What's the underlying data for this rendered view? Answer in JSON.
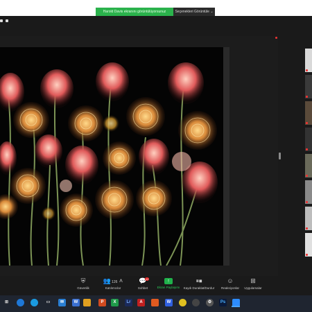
{
  "share_banner": {
    "message": "Harold Davis ekranını görüntülüyorsunuz",
    "view_options": "Seçenekleri Görüntüle ⌄"
  },
  "toolbar": {
    "security": "Güvenlik",
    "participants": "Katılımcılar",
    "participant_count": "126",
    "chat": "Sohbet",
    "chat_badge": "12",
    "share_screen": "Ekran Paylaşımı",
    "record": "Kaydı Duraklat/Durdur",
    "reactions": "Reaksiyonlar",
    "apps": "Uygulamalar"
  },
  "colors": {
    "share_green": "#2bb24c",
    "background_dark": "#1a1a1a",
    "taskbar": "#1f2530",
    "recording_red": "#e33333"
  },
  "taskbar_icons": [
    "windows-start",
    "search",
    "chrome",
    "edge",
    "file-explorer",
    "mail",
    "word",
    "excel",
    "powerpoint",
    "lightroom",
    "acrobat",
    "photos",
    "chrome-2",
    "media",
    "settings",
    "photoshop",
    "zoom"
  ]
}
